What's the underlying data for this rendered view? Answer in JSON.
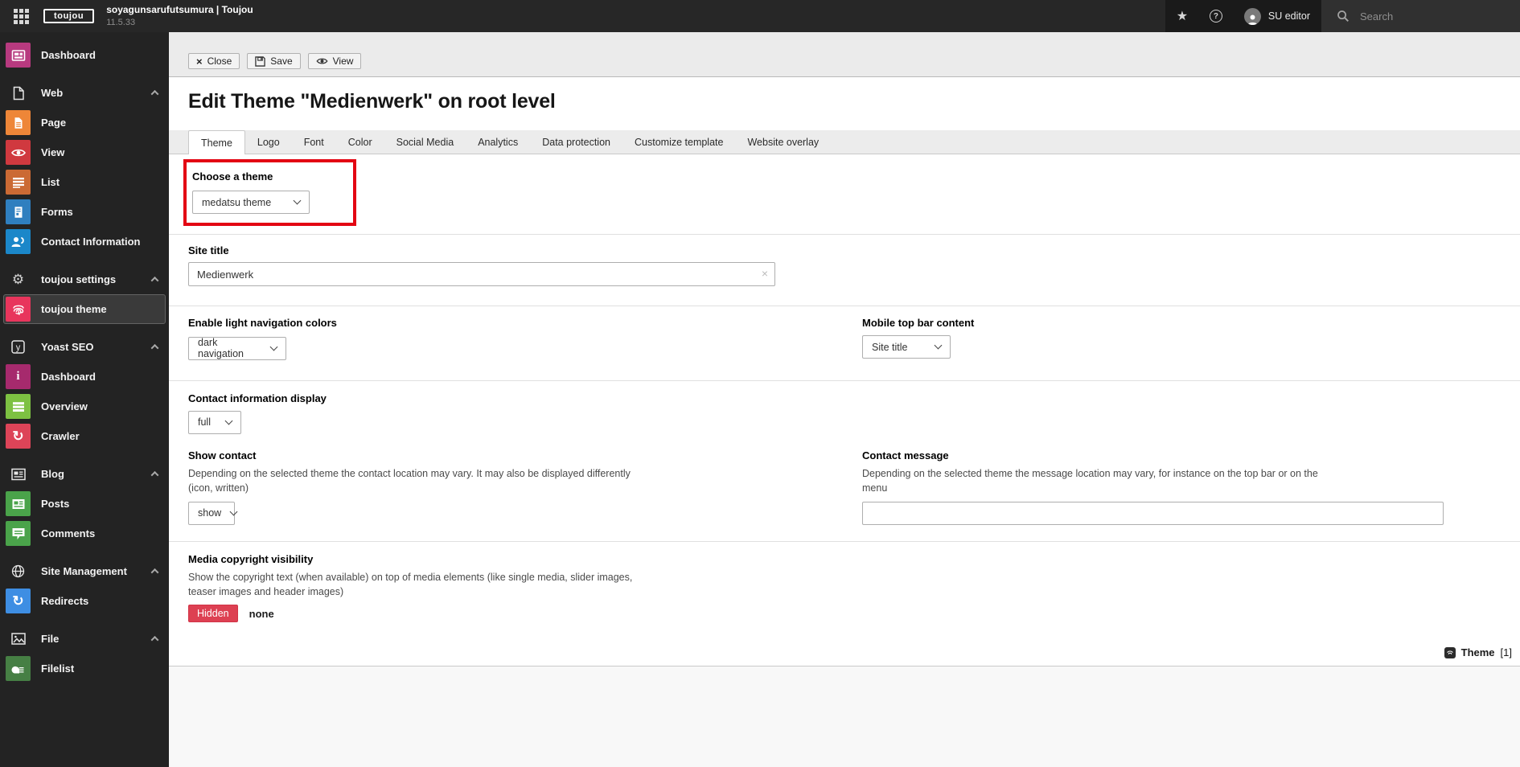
{
  "topbar": {
    "logo": "toujou",
    "site_name": "soyagunsarufutsumura | Toujou",
    "version": "11.5.33",
    "user_label": "SU editor",
    "search_placeholder": "Search",
    "icons": {
      "star": "★",
      "help": "?"
    }
  },
  "sidebar": {
    "items": [
      {
        "label": "Dashboard"
      },
      {
        "label": "Web"
      },
      {
        "label": "Page"
      },
      {
        "label": "View"
      },
      {
        "label": "List"
      },
      {
        "label": "Forms"
      },
      {
        "label": "Contact Information"
      },
      {
        "label": "toujou settings"
      },
      {
        "label": "toujou theme"
      },
      {
        "label": "Yoast SEO"
      },
      {
        "label": "Dashboard"
      },
      {
        "label": "Overview"
      },
      {
        "label": "Crawler"
      },
      {
        "label": "Blog"
      },
      {
        "label": "Posts"
      },
      {
        "label": "Comments"
      },
      {
        "label": "Site Management"
      },
      {
        "label": "Redirects"
      },
      {
        "label": "File"
      },
      {
        "label": "Filelist"
      }
    ],
    "icon_glyphs": {
      "gear": "⚙",
      "refresh": "↻",
      "info": "i",
      "yoast": "y"
    }
  },
  "docheader": {
    "close_label": "Close",
    "save_label": "Save",
    "view_label": "View",
    "close_icon": "×"
  },
  "main": {
    "title": "Edit Theme \"Medienwerk\" on root level",
    "tabs": [
      {
        "label": "Theme"
      },
      {
        "label": "Logo"
      },
      {
        "label": "Font"
      },
      {
        "label": "Color"
      },
      {
        "label": "Social Media"
      },
      {
        "label": "Analytics"
      },
      {
        "label": "Data protection"
      },
      {
        "label": "Customize template"
      },
      {
        "label": "Website overlay"
      }
    ],
    "form": {
      "choose_theme": {
        "label": "Choose a theme",
        "value": "medatsu theme"
      },
      "site_title": {
        "label": "Site title",
        "value": "Medienwerk",
        "clear_icon": "×"
      },
      "nav_colors": {
        "label": "Enable light navigation colors",
        "value": "dark navigation"
      },
      "mobile_topbar": {
        "label": "Mobile top bar content",
        "value": "Site title"
      },
      "contact_display": {
        "label": "Contact information display",
        "value": "full"
      },
      "show_contact": {
        "label": "Show contact",
        "description": "Depending on the selected theme the contact location may vary. It may also be displayed differently\n(icon, written)",
        "value": "show"
      },
      "contact_message": {
        "label": "Contact message",
        "description": "Depending on the selected theme the message location may vary, for instance on the top bar or on the\nmenu",
        "value": ""
      },
      "media_copyright": {
        "label": "Media copyright visibility",
        "description": "Show the copyright text (when available) on top of media elements (like single media, slider images,\nteaser images and header images)",
        "button_label": "Hidden",
        "value": "none"
      }
    },
    "footer": {
      "record_type": "Theme",
      "count": "[1]"
    }
  },
  "colors": {
    "annotation_red": "#e30613",
    "hidden_button": "#dd4052",
    "topbar": "#272727",
    "sidebar": "#232323"
  }
}
